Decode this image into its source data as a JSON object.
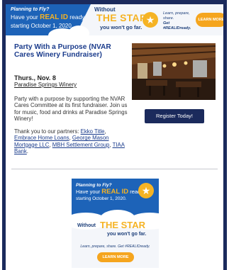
{
  "banner_ad": {
    "line1": "Planning to Fly?",
    "line2_prefix": "Have your ",
    "line2_highlight": "REAL ID",
    "line2_suffix": " ready",
    "line3": "starting October 1, 2020.",
    "without": "Without",
    "the_star": "THE STAR",
    "wont_go": "you won't go far.",
    "learn_text_prefix": "Learn, prepare, share.",
    "learn_text_tag": "Get #REALIDready.",
    "button": "LEARN MORE"
  },
  "event": {
    "title": "Party With a Purpose (NVAR Cares Winery Fundraiser)",
    "date": "Thurs., Nov. 8",
    "venue": "Paradise Springs Winery",
    "description": "Party with a purpose by supporting the NVAR Cares Committee at its first fundraiser. Join us for music, food and drinks at Paradise Springs Winery!",
    "partners_intro": "Thank you to our partners: ",
    "partners": [
      {
        "name": "Ekko Title",
        "sep": ", "
      },
      {
        "name": "Embrace Home Loans",
        "sep": ", "
      },
      {
        "name": "George Mason Mortgage LLC",
        "sep": ", "
      },
      {
        "name": "MBH Settlement Group",
        "sep": ", "
      },
      {
        "name": "TIAA Bank",
        "sep": "."
      }
    ],
    "register_button": "Register Today!"
  },
  "square_ad": {
    "line1": "Planning to Fly?",
    "line2_prefix": "Have your ",
    "line2_highlight": "REAL ID",
    "line2_suffix": " ready",
    "line3": "starting October 1, 2020.",
    "without": "Without",
    "the_star": "THE STAR",
    "wont_go": "you won't go far.",
    "learn_text": "Learn, prepare, share. Get #REALIDready.",
    "button": "LEARN MORE"
  },
  "colors": {
    "frame": "#1b2a5c",
    "title_blue": "#1b3c8c",
    "ad_blue": "#1d63b8",
    "ad_gold": "#f5b324",
    "button_orange": "#f5a51e"
  },
  "icons": {
    "star": "star-icon"
  }
}
